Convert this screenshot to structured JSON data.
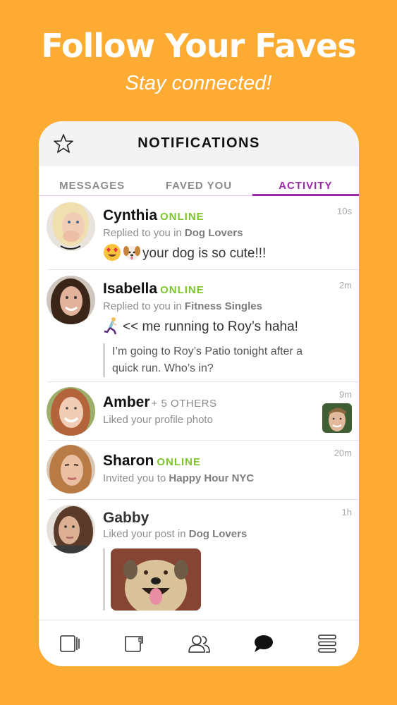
{
  "hero": {
    "title": "Follow Your Faves",
    "subtitle": "Stay connected!"
  },
  "header": {
    "title": "NOTIFICATIONS",
    "left_icon": "star-icon"
  },
  "tabs": [
    {
      "label": "MESSAGES",
      "active": false
    },
    {
      "label": "FAVED YOU",
      "active": false
    },
    {
      "label": "ACTIVITY",
      "active": true
    }
  ],
  "notifications": [
    {
      "name": "Cynthia",
      "status": "ONLINE",
      "action_prefix": "Replied to you in ",
      "action_target": "Dog Lovers",
      "message": "your dog is so cute!!!",
      "emojis": [
        "heart-eyes-emoji",
        "dog-face-emoji"
      ],
      "time": "10s"
    },
    {
      "name": "Isabella",
      "status": "ONLINE",
      "action_prefix": "Replied to you in ",
      "action_target": "Fitness Singles",
      "message": "<< me running to Roy’s haha!",
      "emojis": [
        "woman-running-emoji"
      ],
      "quote": "I’m going to Roy’s Patio tonight after a quick run. Who’s in?",
      "time": "2m"
    },
    {
      "name": "Amber",
      "others": "+ 5 OTHERS",
      "action_prefix": "Liked your profile photo",
      "action_target": "",
      "time": "9m",
      "thumbnail": "profile-photo-thumbnail"
    },
    {
      "name": "Sharon",
      "status": "ONLINE",
      "action_prefix": "Invited you to ",
      "action_target": "Happy Hour NYC",
      "time": "20m"
    },
    {
      "name": "Gabby",
      "action_prefix": "Liked your post in ",
      "action_target": "Dog Lovers",
      "time": "1h",
      "post_image": "dog-photo"
    }
  ],
  "bottom_nav": [
    {
      "icon": "cards-icon",
      "active": false
    },
    {
      "icon": "mug-icon",
      "active": false
    },
    {
      "icon": "people-icon",
      "active": false
    },
    {
      "icon": "chat-bubble-icon",
      "active": true
    },
    {
      "icon": "menu-icon",
      "active": false
    }
  ],
  "colors": {
    "background": "#FDAB33",
    "accent": "#9B2BA6",
    "online": "#7DC42E"
  }
}
